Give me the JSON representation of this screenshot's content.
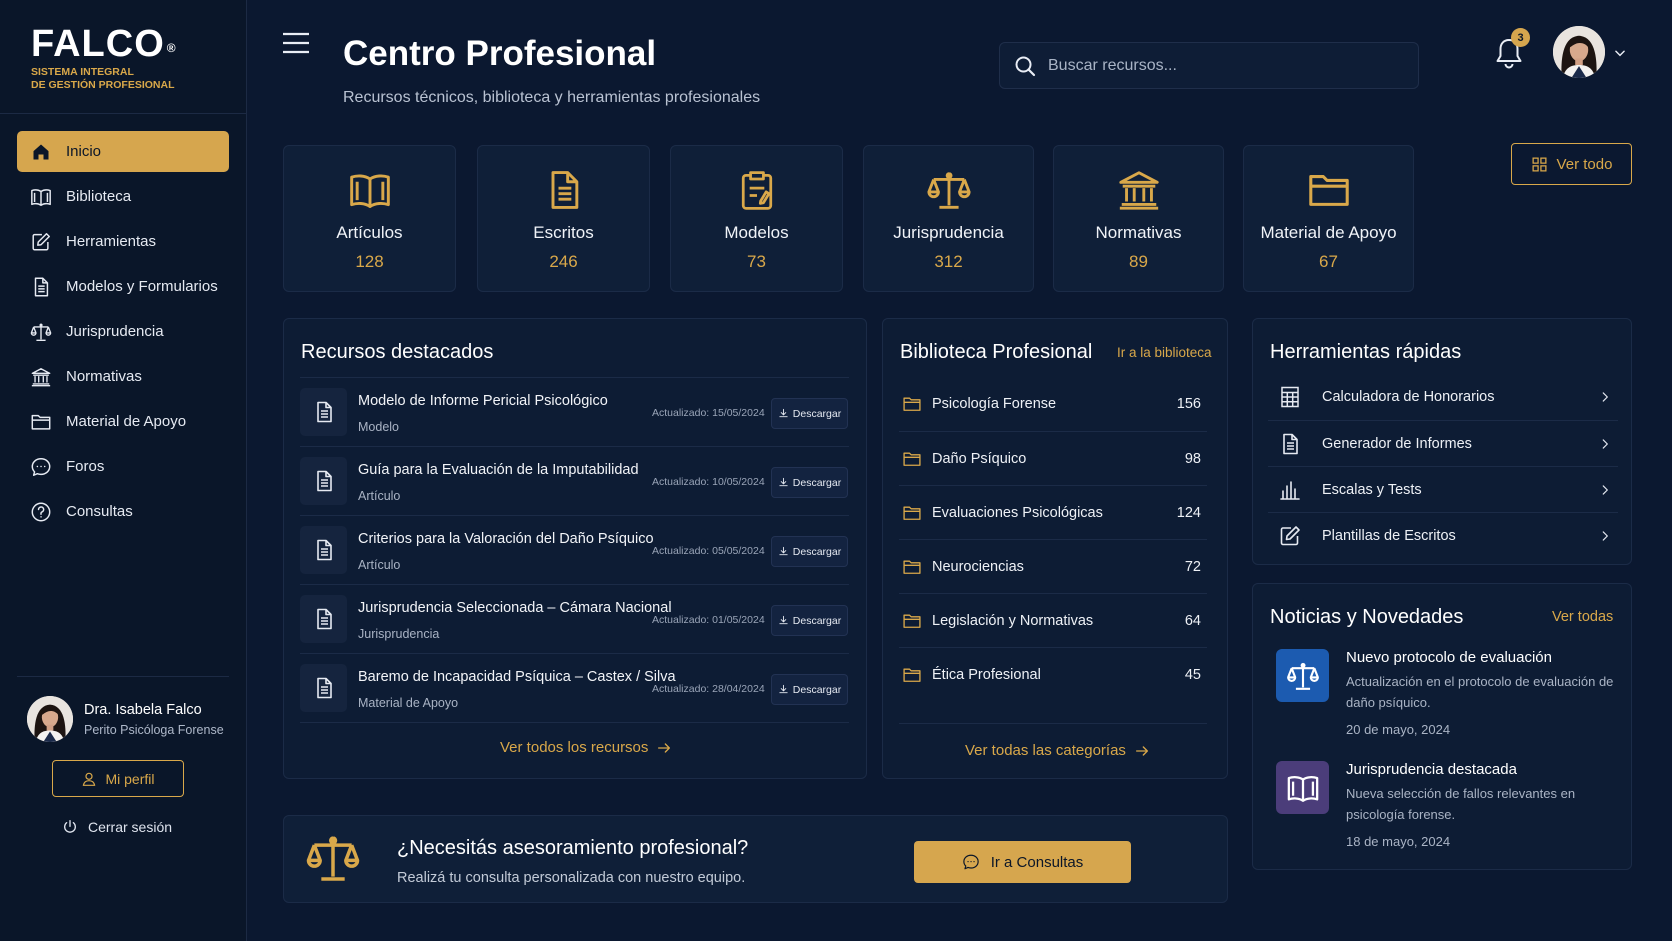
{
  "brand": {
    "name": "FALCO",
    "reg": "®",
    "subtitle_1": "SISTEMA INTEGRAL",
    "subtitle_2": "DE GESTIÓN PROFESIONAL"
  },
  "sidebar": {
    "items": [
      {
        "label": "Inicio",
        "icon": "home-icon",
        "active": true
      },
      {
        "label": "Biblioteca",
        "icon": "book-icon"
      },
      {
        "label": "Herramientas",
        "icon": "edit-icon"
      },
      {
        "label": "Modelos y Formularios",
        "icon": "document-icon"
      },
      {
        "label": "Jurisprudencia",
        "icon": "scales-icon"
      },
      {
        "label": "Normativas",
        "icon": "building-icon"
      },
      {
        "label": "Material de Apoyo",
        "icon": "folder-icon"
      },
      {
        "label": "Foros",
        "icon": "chat-icon"
      },
      {
        "label": "Consultas",
        "icon": "help-icon"
      }
    ],
    "user": {
      "name": "Dra. Isabela Falco",
      "role": "Perito Psicóloga Forense"
    },
    "profile_button": "Mi perfil",
    "logout": "Cerrar sesión"
  },
  "header": {
    "title": "Centro Profesional",
    "subtitle": "Recursos técnicos, biblioteca y herramientas profesionales",
    "search_placeholder": "Buscar recursos...",
    "notifications": "3"
  },
  "categories": [
    {
      "name": "Artículos",
      "count": "128",
      "icon": "book-icon"
    },
    {
      "name": "Escritos",
      "count": "246",
      "icon": "document-icon"
    },
    {
      "name": "Modelos",
      "count": "73",
      "icon": "clipboard-icon"
    },
    {
      "name": "Jurisprudencia",
      "count": "312",
      "icon": "scales-icon"
    },
    {
      "name": "Normativas",
      "count": "89",
      "icon": "building-icon"
    },
    {
      "name": "Material de Apoyo",
      "count": "67",
      "icon": "folder-icon"
    }
  ],
  "view_all": "Ver todo",
  "featured": {
    "title": "Recursos destacados",
    "download_label": "Descargar",
    "items": [
      {
        "title": "Modelo de Informe Pericial Psicológico",
        "type": "Modelo",
        "date": "Actualizado: 15/05/2024"
      },
      {
        "title": "Guía para la Evaluación de la Imputabilidad",
        "type": "Artículo",
        "date": "Actualizado: 10/05/2024"
      },
      {
        "title": "Criterios para la Valoración del Daño Psíquico",
        "type": "Artículo",
        "date": "Actualizado: 05/05/2024"
      },
      {
        "title": "Jurisprudencia Seleccionada – Cámara Nacional",
        "type": "Jurisprudencia",
        "date": "Actualizado: 01/05/2024"
      },
      {
        "title": "Baremo de Incapacidad Psíquica – Castex / Silva",
        "type": "Material de Apoyo",
        "date": "Actualizado: 28/04/2024"
      }
    ],
    "link": "Ver todos los recursos"
  },
  "library": {
    "title": "Biblioteca Profesional",
    "header_link": "Ir a la biblioteca",
    "items": [
      {
        "name": "Psicología Forense",
        "count": "156"
      },
      {
        "name": "Daño Psíquico",
        "count": "98"
      },
      {
        "name": "Evaluaciones Psicológicas",
        "count": "124"
      },
      {
        "name": "Neurociencias",
        "count": "72"
      },
      {
        "name": "Legislación y Normativas",
        "count": "64"
      },
      {
        "name": "Ética Profesional",
        "count": "45"
      }
    ],
    "link": "Ver todas las categorías"
  },
  "tools": {
    "title": "Herramientas rápidas",
    "items": [
      {
        "name": "Calculadora de Honorarios",
        "icon": "calculator-icon"
      },
      {
        "name": "Generador de Informes",
        "icon": "document-icon"
      },
      {
        "name": "Escalas y Tests",
        "icon": "bar-chart-icon"
      },
      {
        "name": "Plantillas de Escritos",
        "icon": "edit-icon"
      }
    ]
  },
  "news": {
    "title": "Noticias y Novedades",
    "link": "Ver todas",
    "items": [
      {
        "title": "Nuevo protocolo de evaluación",
        "desc": "Actualización en el protocolo de evaluación de daño psíquico.",
        "date": "20 de mayo, 2024",
        "icon": "scales-icon",
        "color": "#1c5bb0"
      },
      {
        "title": "Jurisprudencia destacada",
        "desc": "Nueva selección de fallos relevantes en psicología forense.",
        "date": "18 de mayo, 2024",
        "icon": "book-icon",
        "color": "#4b3d7a"
      }
    ]
  },
  "cta": {
    "title": "¿Necesitás asesoramiento profesional?",
    "subtitle": "Realizá tu consulta personalizada con nuestro equipo.",
    "button": "Ir a Consultas"
  },
  "colors": {
    "accent": "#d6a64e",
    "background": "#0b1830",
    "panel": "#0d1c34"
  }
}
